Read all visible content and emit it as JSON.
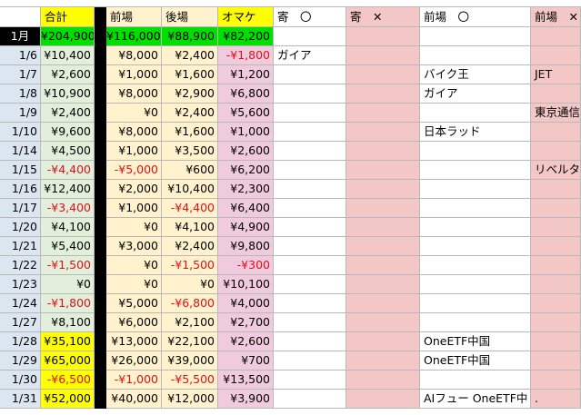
{
  "header": {
    "total_label": "合計",
    "zenba_label": "前場",
    "goba_label": "後場",
    "omake_label": "オマケ",
    "yori_maru_label": "寄　〇",
    "yori_batsu_label": "寄　✕",
    "zenba_maru_label": "前場　〇",
    "zenba_batsu_label": "前場　✕"
  },
  "month": {
    "label": "1月",
    "total": "¥204,900",
    "zenba": "¥116,000",
    "goba": "¥88,900",
    "omake": "¥82,200"
  },
  "rows": [
    {
      "date": "1/6",
      "total": "¥10,400",
      "zenba": "¥8,000",
      "goba": "¥2,400",
      "omake": "-¥1,800",
      "yori_maru": "ガイア",
      "zenba_maru": "",
      "zenba_batsu": ""
    },
    {
      "date": "1/7",
      "total": "¥2,600",
      "zenba": "¥1,000",
      "goba": "¥1,600",
      "omake": "¥1,200",
      "yori_maru": "",
      "zenba_maru": "バイク王",
      "zenba_batsu": "JET"
    },
    {
      "date": "1/8",
      "total": "¥10,900",
      "zenba": "¥8,000",
      "goba": "¥2,900",
      "omake": "¥6,800",
      "yori_maru": "",
      "zenba_maru": "ガイア",
      "zenba_batsu": ""
    },
    {
      "date": "1/9",
      "total": "¥2,400",
      "zenba": "¥0",
      "goba": "¥2,400",
      "omake": "¥5,600",
      "yori_maru": "",
      "zenba_maru": "",
      "zenba_batsu": "東京通信"
    },
    {
      "date": "1/10",
      "total": "¥9,600",
      "zenba": "¥8,000",
      "goba": "¥1,600",
      "omake": "¥1,000",
      "yori_maru": "",
      "zenba_maru": "日本ラッド",
      "zenba_batsu": ""
    },
    {
      "date": "1/14",
      "total": "¥4,500",
      "zenba": "¥1,000",
      "goba": "¥3,500",
      "omake": "¥2,600",
      "yori_maru": "",
      "zenba_maru": "",
      "zenba_batsu": ""
    },
    {
      "date": "1/15",
      "total": "-¥4,400",
      "zenba": "-¥5,000",
      "goba": "¥600",
      "omake": "¥6,200",
      "yori_maru": "",
      "zenba_maru": "",
      "zenba_batsu": "リベルタ"
    },
    {
      "date": "1/16",
      "total": "¥12,400",
      "zenba": "¥2,000",
      "goba": "¥10,400",
      "omake": "¥2,300",
      "yori_maru": "",
      "zenba_maru": "",
      "zenba_batsu": ""
    },
    {
      "date": "1/17",
      "total": "-¥3,400",
      "zenba": "¥1,000",
      "goba": "-¥4,400",
      "omake": "¥6,400",
      "yori_maru": "",
      "zenba_maru": "",
      "zenba_batsu": ""
    },
    {
      "date": "1/20",
      "total": "¥4,100",
      "zenba": "¥0",
      "goba": "¥4,100",
      "omake": "¥4,900",
      "yori_maru": "",
      "zenba_maru": "",
      "zenba_batsu": ""
    },
    {
      "date": "1/21",
      "total": "¥5,400",
      "zenba": "¥3,000",
      "goba": "¥2,400",
      "omake": "¥9,800",
      "yori_maru": "",
      "zenba_maru": "",
      "zenba_batsu": ""
    },
    {
      "date": "1/22",
      "total": "-¥1,500",
      "zenba": "¥0",
      "goba": "-¥1,500",
      "omake": "-¥300",
      "yori_maru": "",
      "zenba_maru": "",
      "zenba_batsu": ""
    },
    {
      "date": "1/23",
      "total": "¥0",
      "zenba": "¥0",
      "goba": "¥0",
      "omake": "¥10,100",
      "yori_maru": "",
      "zenba_maru": "",
      "zenba_batsu": ""
    },
    {
      "date": "1/24",
      "total": "-¥1,800",
      "zenba": "¥5,000",
      "goba": "-¥6,800",
      "omake": "¥4,000",
      "yori_maru": "",
      "zenba_maru": "",
      "zenba_batsu": ""
    },
    {
      "date": "1/27",
      "total": "¥8,100",
      "zenba": "¥6,000",
      "goba": "¥2,100",
      "omake": "¥2,700",
      "yori_maru": "",
      "zenba_maru": "",
      "zenba_batsu": ""
    },
    {
      "date": "1/28",
      "total": "¥35,100",
      "zenba": "¥13,000",
      "goba": "¥22,100",
      "omake": "¥2,600",
      "yori_maru": "",
      "zenba_maru": "OneETF中国",
      "zenba_batsu": ""
    },
    {
      "date": "1/29",
      "total": "¥65,000",
      "zenba": "¥26,000",
      "goba": "¥39,000",
      "omake": "¥700",
      "yori_maru": "",
      "zenba_maru": "OneETF中国",
      "zenba_batsu": ""
    },
    {
      "date": "1/30",
      "total": "-¥6,500",
      "zenba": "-¥1,000",
      "goba": "-¥5,500",
      "omake": "¥13,500",
      "yori_maru": "",
      "zenba_maru": "",
      "zenba_batsu": ""
    },
    {
      "date": "1/31",
      "total": "¥52,000",
      "zenba": "¥40,000",
      "goba": "¥12,000",
      "omake": "¥3,900",
      "yori_maru": "",
      "zenba_maru": "AIフュー OneETF中",
      "zenba_batsu": "."
    }
  ],
  "colors": {
    "date_bg": "#dce6f1",
    "month_label_bg": "#000000",
    "header_yellow": "#ffff00",
    "month_green": "#00e000",
    "total_bg": "#e2efda",
    "total_highlight": "#ffff00",
    "zenba_bg": "#fff2cc",
    "goba_bg": "#fff2cc",
    "omake_bg": "#f0cbdd",
    "batsu_bg": "#f4c7c7",
    "negative_text": "#e0101a",
    "separator": "#000000",
    "grid": "#b8b8b8"
  }
}
